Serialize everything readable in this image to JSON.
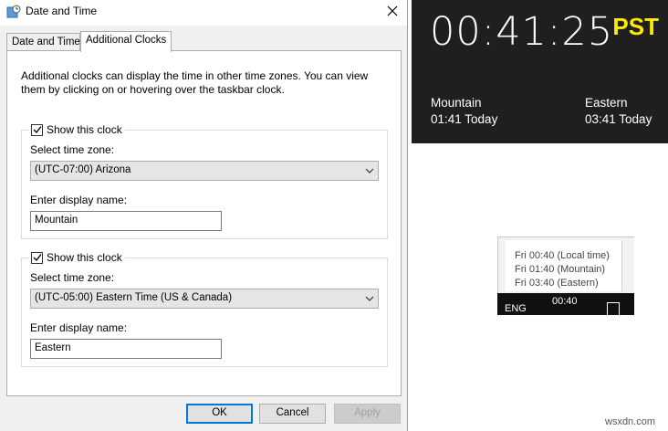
{
  "dialog": {
    "title": "Date and Time",
    "tabs": [
      {
        "label": "Date and Time",
        "active": false
      },
      {
        "label": "Additional Clocks",
        "active": true
      }
    ],
    "intro": "Additional clocks can display the time in other time zones. You can view them by clicking on or hovering over the taskbar clock.",
    "clocks": [
      {
        "show_label": "Show this clock",
        "checked": true,
        "tz_label": "Select time zone:",
        "tz_value": "(UTC-07:00) Arizona",
        "name_label": "Enter display name:",
        "name_value": "Mountain"
      },
      {
        "show_label": "Show this clock",
        "checked": true,
        "tz_label": "Select time zone:",
        "tz_value": "(UTC-05:00) Eastern Time (US & Canada)",
        "name_label": "Enter display name:",
        "name_value": "Eastern"
      }
    ],
    "buttons": {
      "ok": "OK",
      "cancel": "Cancel",
      "apply": "Apply"
    }
  },
  "flyout": {
    "time": "00:41:25",
    "label": "PST",
    "clocks": [
      {
        "name": "Mountain",
        "time": "01:41 Today"
      },
      {
        "name": "Eastern",
        "time": "03:41 Today"
      }
    ]
  },
  "tooltip": {
    "lines": [
      "Fri 00:40  (Local time)",
      "Fri 01:40  (Mountain)",
      "Fri 03:40  (Eastern)"
    ]
  },
  "taskbar": {
    "language": "ENG",
    "time": "00:40"
  },
  "watermark": "wsxdn.com",
  "colors": {
    "accent": "#0078d7",
    "pst_label": "#ffea00",
    "flyout_bg": "#1f1f1f"
  }
}
